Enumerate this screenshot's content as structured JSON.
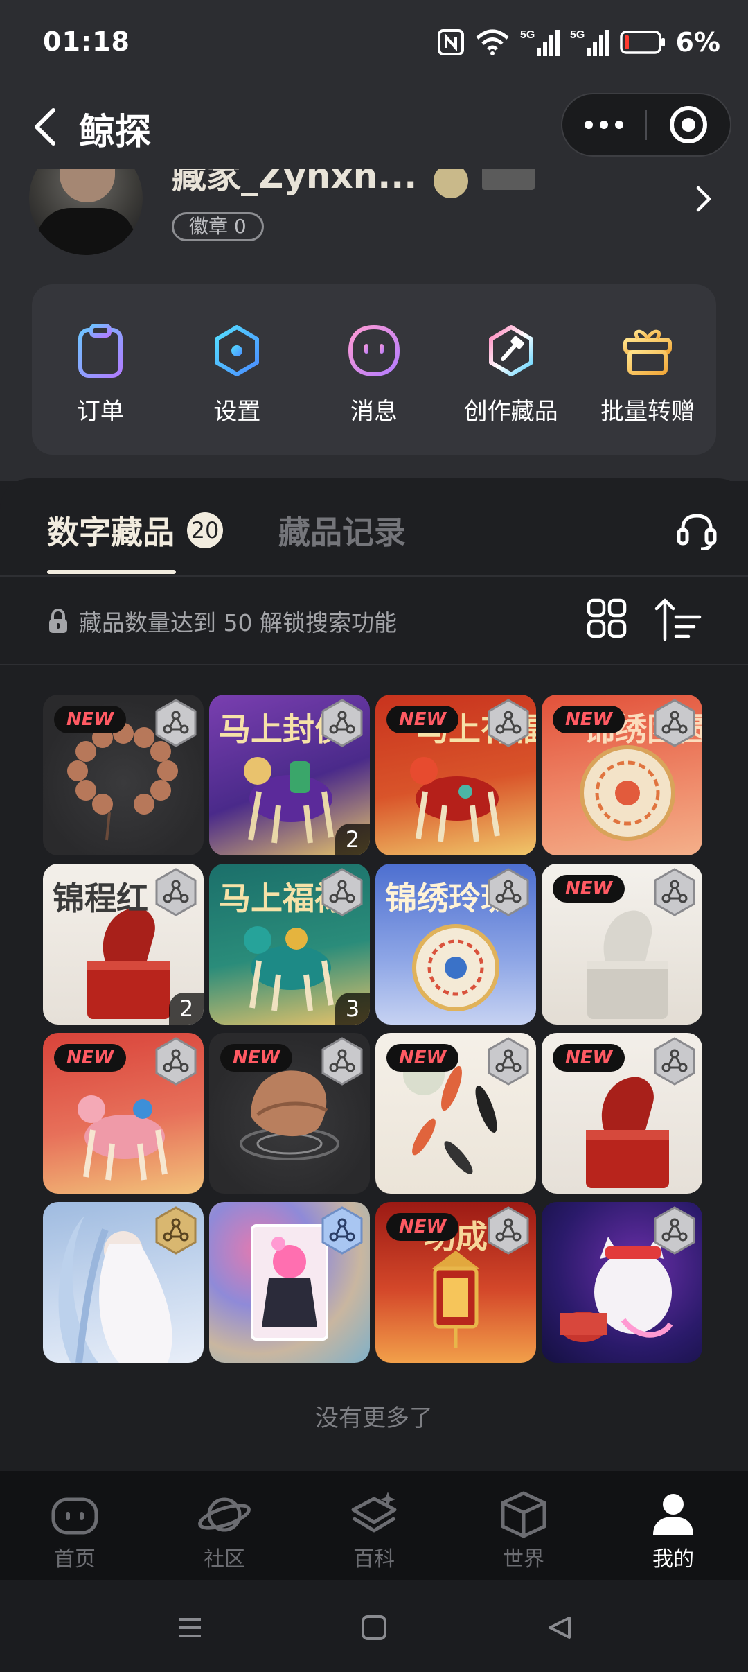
{
  "status_bar": {
    "time": "01:18",
    "battery": "6%",
    "net1": "5G",
    "net2": "5G"
  },
  "header": {
    "title": "鲸探"
  },
  "profile": {
    "nickname": "藏家_Zyhxh...",
    "medal": "徽章 0"
  },
  "quick_actions": [
    {
      "label": "订单",
      "icon": "clipboard-icon"
    },
    {
      "label": "设置",
      "icon": "settings-hexagon-icon"
    },
    {
      "label": "消息",
      "icon": "message-face-icon"
    },
    {
      "label": "创作藏品",
      "icon": "create-collectible-icon"
    },
    {
      "label": "批量转赠",
      "icon": "gift-icon"
    }
  ],
  "tabs": {
    "active": "数字藏品",
    "count": "20",
    "inactive": "藏品记录"
  },
  "notice": "藏品数量达到 50 解锁搜索功能",
  "new_label": "NEW",
  "collectibles": [
    {
      "title": "",
      "new": true,
      "count": "",
      "theme": "beads"
    },
    {
      "title": "马上封侯",
      "new": false,
      "count": "2",
      "theme": "purple-horse"
    },
    {
      "title": "马上有福",
      "new": true,
      "count": "",
      "theme": "red-horse"
    },
    {
      "title": "锦绣团圆",
      "new": true,
      "count": "",
      "theme": "orange-plate"
    },
    {
      "title": "锦程红",
      "new": false,
      "count": "2",
      "theme": "red-seal"
    },
    {
      "title": "马上福禄",
      "new": false,
      "count": "3",
      "theme": "teal-horse"
    },
    {
      "title": "锦绣玲珑",
      "new": false,
      "count": "",
      "theme": "blue-plate"
    },
    {
      "title": "",
      "new": true,
      "count": "",
      "theme": "white-jade"
    },
    {
      "title": "",
      "new": true,
      "count": "",
      "theme": "pink-horse"
    },
    {
      "title": "",
      "new": true,
      "count": "",
      "theme": "walnut"
    },
    {
      "title": "",
      "new": true,
      "count": "",
      "theme": "koi"
    },
    {
      "title": "",
      "new": true,
      "count": "",
      "theme": "red-seal-white"
    },
    {
      "title": "",
      "new": false,
      "count": "",
      "theme": "blue-girl"
    },
    {
      "title": "",
      "new": false,
      "count": "",
      "theme": "card-girl"
    },
    {
      "title": "功成",
      "new": true,
      "count": "",
      "theme": "lantern"
    },
    {
      "title": "",
      "new": false,
      "count": "",
      "theme": "lucky-cat"
    }
  ],
  "footer_text": "没有更多了",
  "bottom_nav": [
    {
      "label": "首页",
      "icon": "home-bot-icon",
      "active": false
    },
    {
      "label": "社区",
      "icon": "planet-icon",
      "active": false
    },
    {
      "label": "百科",
      "icon": "encyclopedia-icon",
      "active": false
    },
    {
      "label": "世界",
      "icon": "cube-icon",
      "active": false
    },
    {
      "label": "我的",
      "icon": "profile-icon",
      "active": true
    }
  ],
  "colors": {
    "bg": "#1e1f22",
    "header": "#2c2d31",
    "accent": "#f2ecdf",
    "new_tag": "#ff5a63"
  }
}
